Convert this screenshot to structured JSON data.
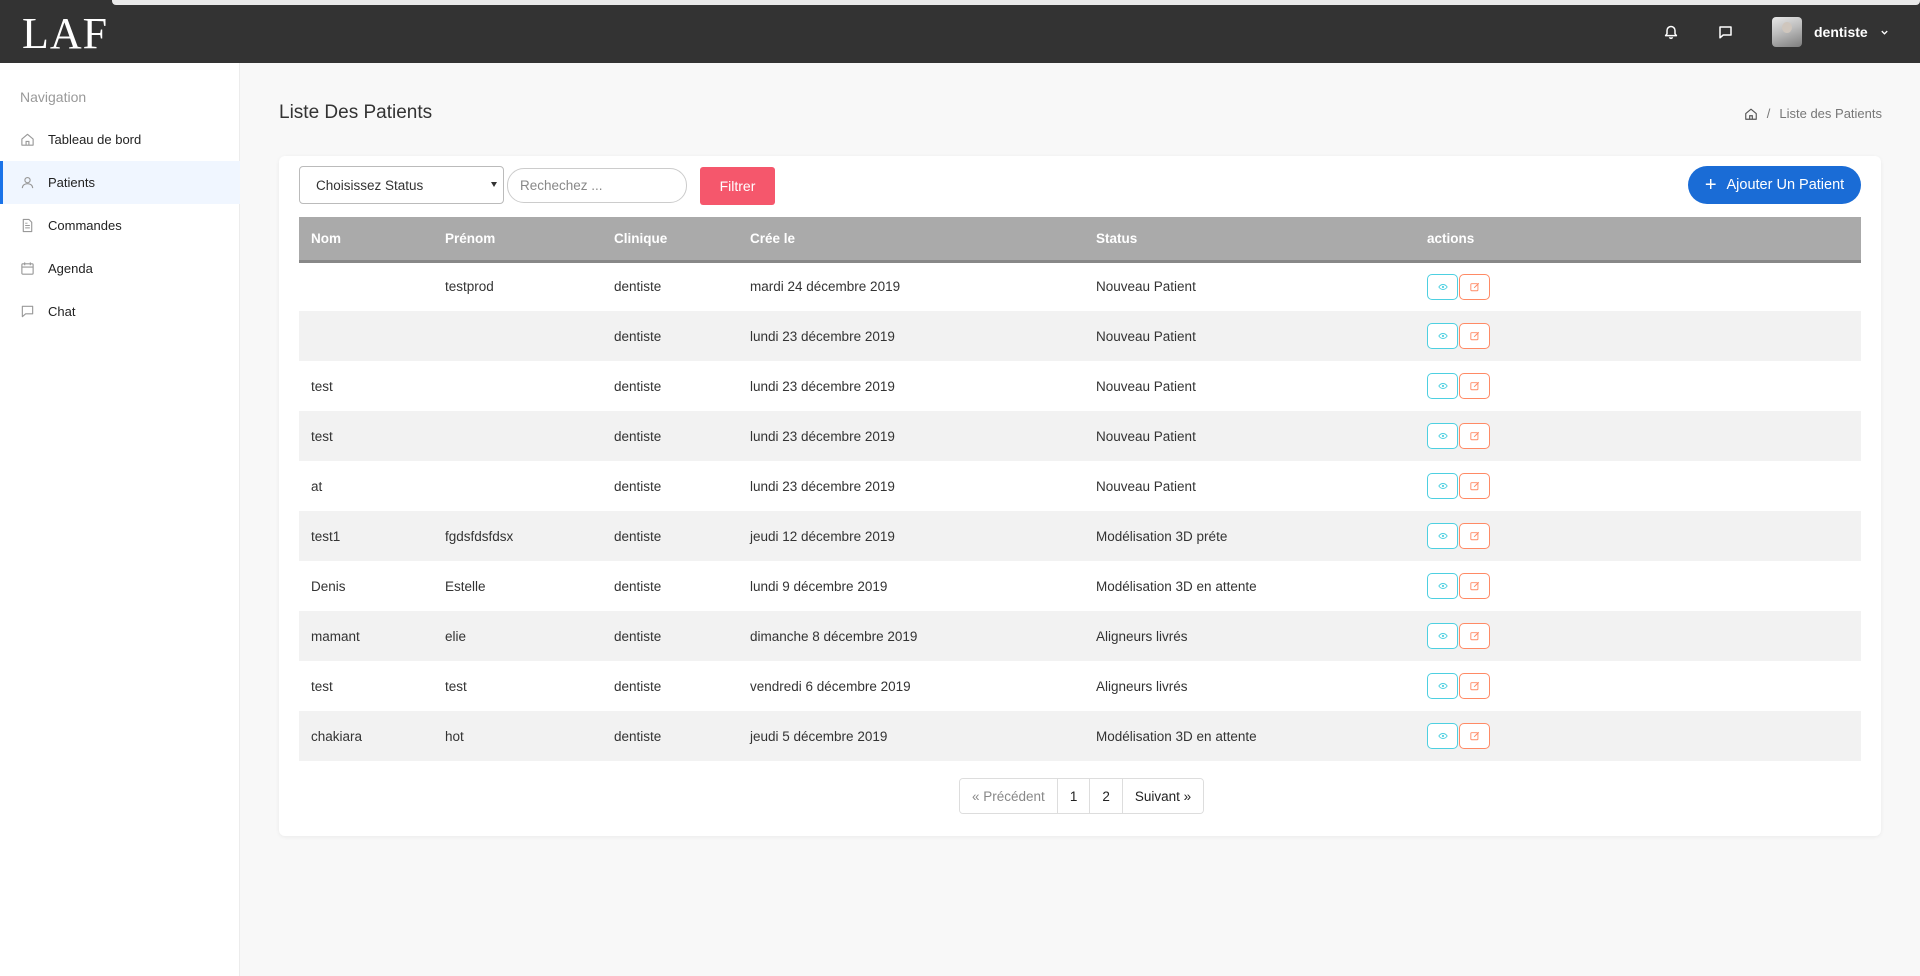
{
  "app": {
    "logo": "LAF"
  },
  "topbar": {
    "user": {
      "name": "dentiste"
    }
  },
  "sidebar": {
    "title": "Navigation",
    "items": [
      {
        "label": "Tableau de bord",
        "icon": "home-icon",
        "active": false
      },
      {
        "label": "Patients",
        "icon": "user-icon",
        "active": true
      },
      {
        "label": "Commandes",
        "icon": "document-icon",
        "active": false
      },
      {
        "label": "Agenda",
        "icon": "calendar-icon",
        "active": false
      },
      {
        "label": "Chat",
        "icon": "chat-icon",
        "active": false
      }
    ]
  },
  "page": {
    "title": "Liste Des Patients",
    "breadcrumb": {
      "current": "Liste des Patients"
    }
  },
  "filters": {
    "status_select": "Choisissez Status",
    "search_placeholder": "Rechechez ...",
    "filter_button": "Filtrer",
    "add_button": "Ajouter Un Patient"
  },
  "table": {
    "headers": [
      "Nom",
      "Prénom",
      "Clinique",
      "Crée le",
      "Status",
      "actions"
    ],
    "rows": [
      {
        "nom": "",
        "prenom": "testprod",
        "clinique": "dentiste",
        "cree_le": "mardi 24 décembre 2019",
        "status": "Nouveau Patient"
      },
      {
        "nom": "",
        "prenom": "",
        "clinique": "dentiste",
        "cree_le": "lundi 23 décembre 2019",
        "status": "Nouveau Patient"
      },
      {
        "nom": "test",
        "prenom": "",
        "clinique": "dentiste",
        "cree_le": "lundi 23 décembre 2019",
        "status": "Nouveau Patient"
      },
      {
        "nom": "test",
        "prenom": "",
        "clinique": "dentiste",
        "cree_le": "lundi 23 décembre 2019",
        "status": "Nouveau Patient"
      },
      {
        "nom": "at",
        "prenom": "",
        "clinique": "dentiste",
        "cree_le": "lundi 23 décembre 2019",
        "status": "Nouveau Patient"
      },
      {
        "nom": "test1",
        "prenom": "fgdsfdsfdsx",
        "clinique": "dentiste",
        "cree_le": "jeudi 12 décembre 2019",
        "status": "Modélisation 3D préte"
      },
      {
        "nom": "Denis",
        "prenom": "Estelle",
        "clinique": "dentiste",
        "cree_le": "lundi 9 décembre 2019",
        "status": "Modélisation 3D en attente"
      },
      {
        "nom": "mamant",
        "prenom": "elie",
        "clinique": "dentiste",
        "cree_le": "dimanche 8 décembre 2019",
        "status": "Aligneurs livrés"
      },
      {
        "nom": "test",
        "prenom": "test",
        "clinique": "dentiste",
        "cree_le": "vendredi 6 décembre 2019",
        "status": "Aligneurs livrés"
      },
      {
        "nom": "chakiara",
        "prenom": "hot",
        "clinique": "dentiste",
        "cree_le": "jeudi 5 décembre 2019",
        "status": "Modélisation 3D en attente"
      }
    ]
  },
  "pagination": {
    "prev": "« Précédent",
    "pages": [
      "1",
      "2"
    ],
    "next": "Suivant »"
  },
  "colors": {
    "topbar": "#333333",
    "accent": "#1a6cd6",
    "filter": "#f5576c",
    "view_action": "#4dd0e1",
    "edit_action": "#ff8a65"
  }
}
